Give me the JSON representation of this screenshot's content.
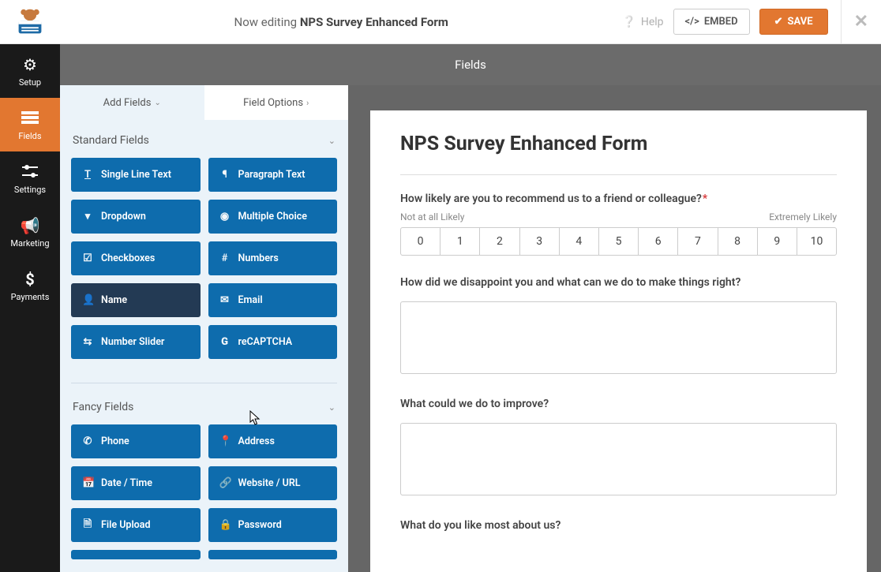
{
  "topbar": {
    "editing_prefix": "Now editing",
    "form_name": "NPS Survey Enhanced Form",
    "help": "Help",
    "embed": "EMBED",
    "save": "SAVE"
  },
  "nav": [
    {
      "label": "Setup",
      "icon": "gear"
    },
    {
      "label": "Fields",
      "icon": "list"
    },
    {
      "label": "Settings",
      "icon": "sliders"
    },
    {
      "label": "Marketing",
      "icon": "bullhorn"
    },
    {
      "label": "Payments",
      "icon": "dollar"
    }
  ],
  "fields_header": "Fields",
  "panel_tabs": {
    "add": "Add Fields",
    "options": "Field Options"
  },
  "sections": {
    "standard": {
      "title": "Standard Fields",
      "items": [
        {
          "icon": "T",
          "label": "Single Line Text"
        },
        {
          "icon": "¶",
          "label": "Paragraph Text"
        },
        {
          "icon": "▾",
          "label": "Dropdown"
        },
        {
          "icon": "◉",
          "label": "Multiple Choice"
        },
        {
          "icon": "☑",
          "label": "Checkboxes"
        },
        {
          "icon": "#",
          "label": "Numbers"
        },
        {
          "icon": "👤",
          "label": "Name"
        },
        {
          "icon": "✉",
          "label": "Email"
        },
        {
          "icon": "⇆",
          "label": "Number Slider"
        },
        {
          "icon": "G",
          "label": "reCAPTCHA"
        }
      ]
    },
    "fancy": {
      "title": "Fancy Fields",
      "items": [
        {
          "icon": "📞",
          "label": "Phone"
        },
        {
          "icon": "📍",
          "label": "Address"
        },
        {
          "icon": "📅",
          "label": "Date / Time"
        },
        {
          "icon": "🔗",
          "label": "Website / URL"
        },
        {
          "icon": "📄",
          "label": "File Upload"
        },
        {
          "icon": "🔒",
          "label": "Password"
        }
      ]
    }
  },
  "preview": {
    "title": "NPS Survey Enhanced Form",
    "q1": "How likely are you to recommend us to a friend or colleague?",
    "low": "Not at all Likely",
    "high": "Extremely Likely",
    "scale": [
      "0",
      "1",
      "2",
      "3",
      "4",
      "5",
      "6",
      "7",
      "8",
      "9",
      "10"
    ],
    "q2": "How did we disappoint you and what can we do to make things right?",
    "q3": "What could we do to improve?",
    "q4": "What do you like most about us?"
  }
}
